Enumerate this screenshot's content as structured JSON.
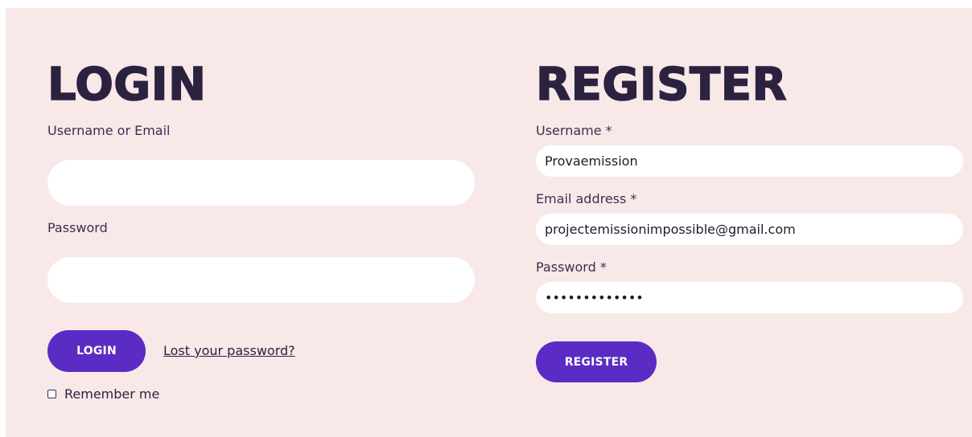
{
  "login": {
    "title": "LOGIN",
    "username_label": "Username or Email",
    "username_value": "",
    "password_label": "Password",
    "password_value": "",
    "submit_label": "LOGIN",
    "lost_password": "Lost your password?",
    "remember_me": "Remember me"
  },
  "register": {
    "title": "REGISTER",
    "username_label": "Username *",
    "username_value": "Provaemission",
    "email_label": "Email address *",
    "email_value": "projectemissionimpossible@gmail.com",
    "password_label": "Password *",
    "password_value": "•••••••••••••",
    "submit_label": "REGISTER"
  },
  "colors": {
    "background": "#f8e9e8",
    "heading": "#2b2240",
    "button": "#5a2cc4",
    "field": "#ffffff"
  }
}
